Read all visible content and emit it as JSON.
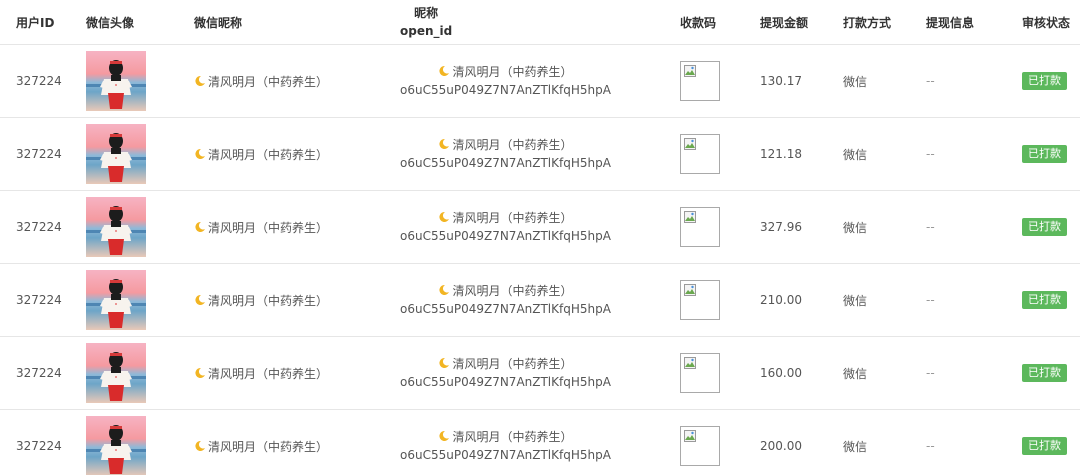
{
  "headers": {
    "user_id": "用户ID",
    "avatar": "微信头像",
    "nickname": "微信昵称",
    "nick_openid_line1": "昵称",
    "nick_openid_line2": "open_id",
    "qr": "收款码",
    "amount": "提现金额",
    "method": "打款方式",
    "info": "提现信息",
    "status": "审核状态"
  },
  "rows": [
    {
      "user_id": "327224",
      "nickname": "清风明月（中药养生）",
      "open_id": "o6uC55uP049Z7N7AnZTlKfqH5hpA",
      "amount": "130.17",
      "method": "微信",
      "info": "--",
      "status": "已打款"
    },
    {
      "user_id": "327224",
      "nickname": "清风明月（中药养生）",
      "open_id": "o6uC55uP049Z7N7AnZTlKfqH5hpA",
      "amount": "121.18",
      "method": "微信",
      "info": "--",
      "status": "已打款"
    },
    {
      "user_id": "327224",
      "nickname": "清风明月（中药养生）",
      "open_id": "o6uC55uP049Z7N7AnZTlKfqH5hpA",
      "amount": "327.96",
      "method": "微信",
      "info": "--",
      "status": "已打款"
    },
    {
      "user_id": "327224",
      "nickname": "清风明月（中药养生）",
      "open_id": "o6uC55uP049Z7N7AnZTlKfqH5hpA",
      "amount": "210.00",
      "method": "微信",
      "info": "--",
      "status": "已打款"
    },
    {
      "user_id": "327224",
      "nickname": "清风明月（中药养生）",
      "open_id": "o6uC55uP049Z7N7AnZTlKfqH5hpA",
      "amount": "160.00",
      "method": "微信",
      "info": "--",
      "status": "已打款"
    },
    {
      "user_id": "327224",
      "nickname": "清风明月（中药养生）",
      "open_id": "o6uC55uP049Z7N7AnZTlKfqH5hpA",
      "amount": "200.00",
      "method": "微信",
      "info": "--",
      "status": "已打款"
    }
  ],
  "icons": {
    "moon": "moon-emoji-icon",
    "broken_image": "broken-image-icon"
  },
  "colors": {
    "status_badge": "#5cb85c",
    "border": "#e6e6e6"
  }
}
